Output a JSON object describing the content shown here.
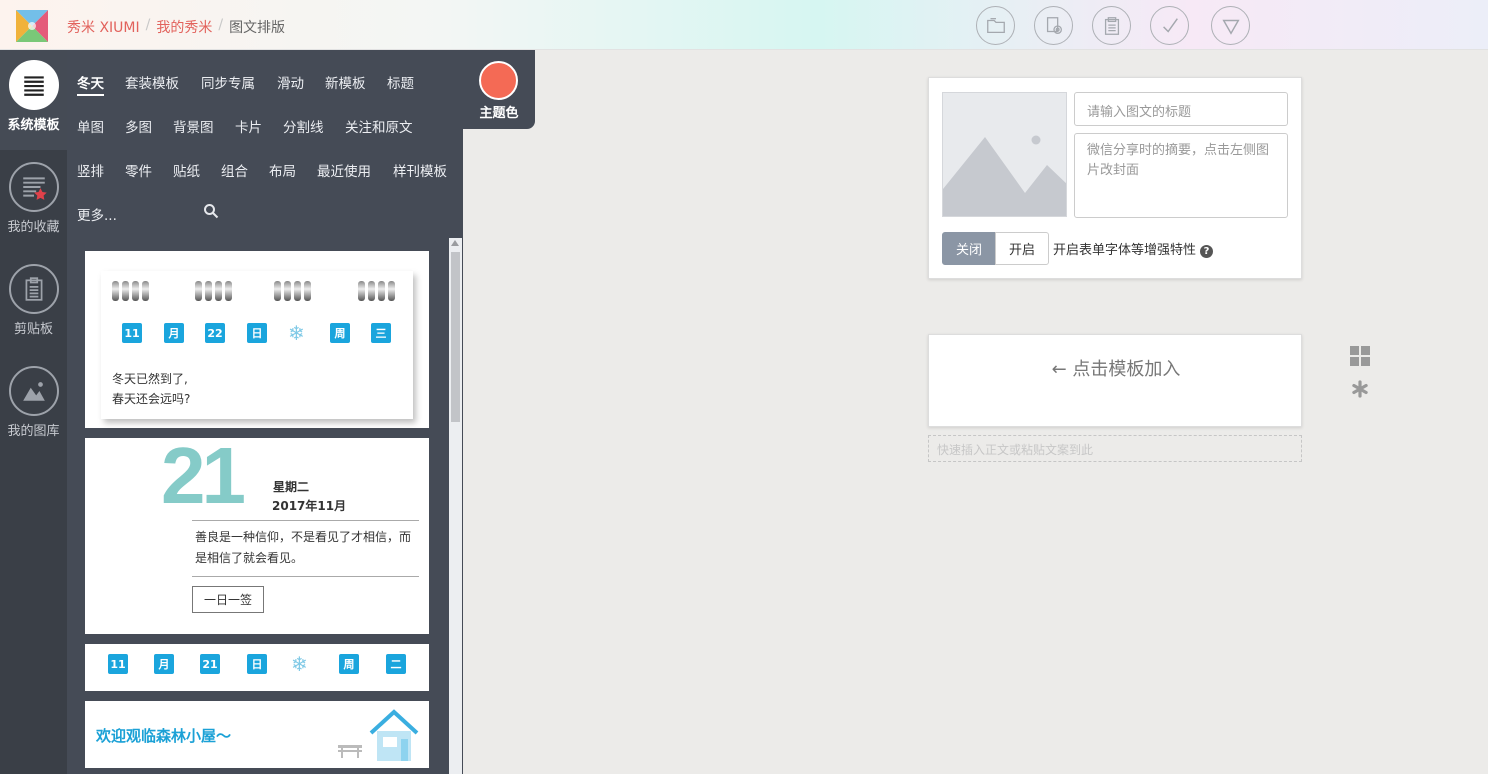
{
  "header": {
    "brand": "秀米 XIUMI",
    "breadcrumb_separator": "/",
    "breadcrumb_my": "我的秀米",
    "breadcrumb_current": "图文排版",
    "tools": [
      "folder-icon",
      "copy-settings-icon",
      "clipboard-icon",
      "check-icon",
      "triangle-down-icon"
    ]
  },
  "rail": {
    "items": [
      {
        "label": "系统模板",
        "icon": "menu-lines-icon"
      },
      {
        "label": "我的收藏",
        "icon": "favorites-icon"
      },
      {
        "label": "剪贴板",
        "icon": "clipboard-icon"
      },
      {
        "label": "我的图库",
        "icon": "gallery-icon"
      }
    ]
  },
  "panel": {
    "theme_label": "主题色",
    "theme_color": "#f46a55",
    "categories": [
      "冬天",
      "套装模板",
      "同步专属",
      "滑动",
      "新模板",
      "标题",
      "单图",
      "多图",
      "背景图",
      "卡片",
      "分割线",
      "关注和原文",
      "竖排",
      "零件",
      "贴纸",
      "组合",
      "布局",
      "最近使用",
      "样刊模板",
      "更多..."
    ],
    "cards": {
      "card1": {
        "dates": [
          "11",
          "月",
          "22",
          "日",
          "周",
          "三"
        ],
        "line1": "冬天已然到了,",
        "line2": "春天还会远吗?"
      },
      "card2": {
        "day": "21",
        "weekday": "星期二",
        "year_month": "2017年11月",
        "quote": "善良是一种信仰，不是看见了才相信，而是相信了就会看见。",
        "button": "一日一签"
      },
      "card3": {
        "dates": [
          "11",
          "月",
          "21",
          "日",
          "周",
          "二"
        ]
      },
      "card4": {
        "title": "欢迎观临森林小屋〜"
      }
    }
  },
  "editor": {
    "title_placeholder": "请输入图文的标题",
    "summary_placeholder": "微信分享时的摘要，点击左侧图片改封面",
    "toggle_off": "关闭",
    "toggle_on": "开启",
    "toggle_label": "开启表单字体等增强特性",
    "drop_hint": "← 点击模板加入",
    "paste_hint": "快速插入正文或粘贴文案到此"
  },
  "colors": {
    "accent_blue": "#1aa5dd",
    "teal": "#85cbc8",
    "panel_bg": "#454b56",
    "rail_bg": "#3a3f47",
    "breadcrumb_red": "#e2625c"
  }
}
